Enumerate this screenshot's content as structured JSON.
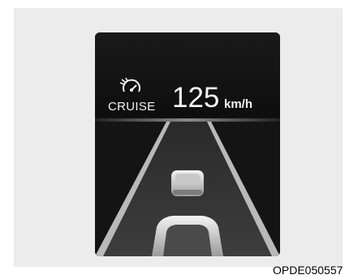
{
  "cluster": {
    "mode_label": "CRUISE",
    "set_speed": "125",
    "speed_unit": "km/h",
    "mode_icon": "cruise-control-icon"
  },
  "scene": {
    "lead_vehicle_icon": "lead-vehicle-icon",
    "own_vehicle_icon": "own-vehicle-icon"
  },
  "caption": "OPDE050557",
  "colors": {
    "display_background": "#111111",
    "text": "#f5f5f5",
    "frame_background": "#ececec"
  }
}
